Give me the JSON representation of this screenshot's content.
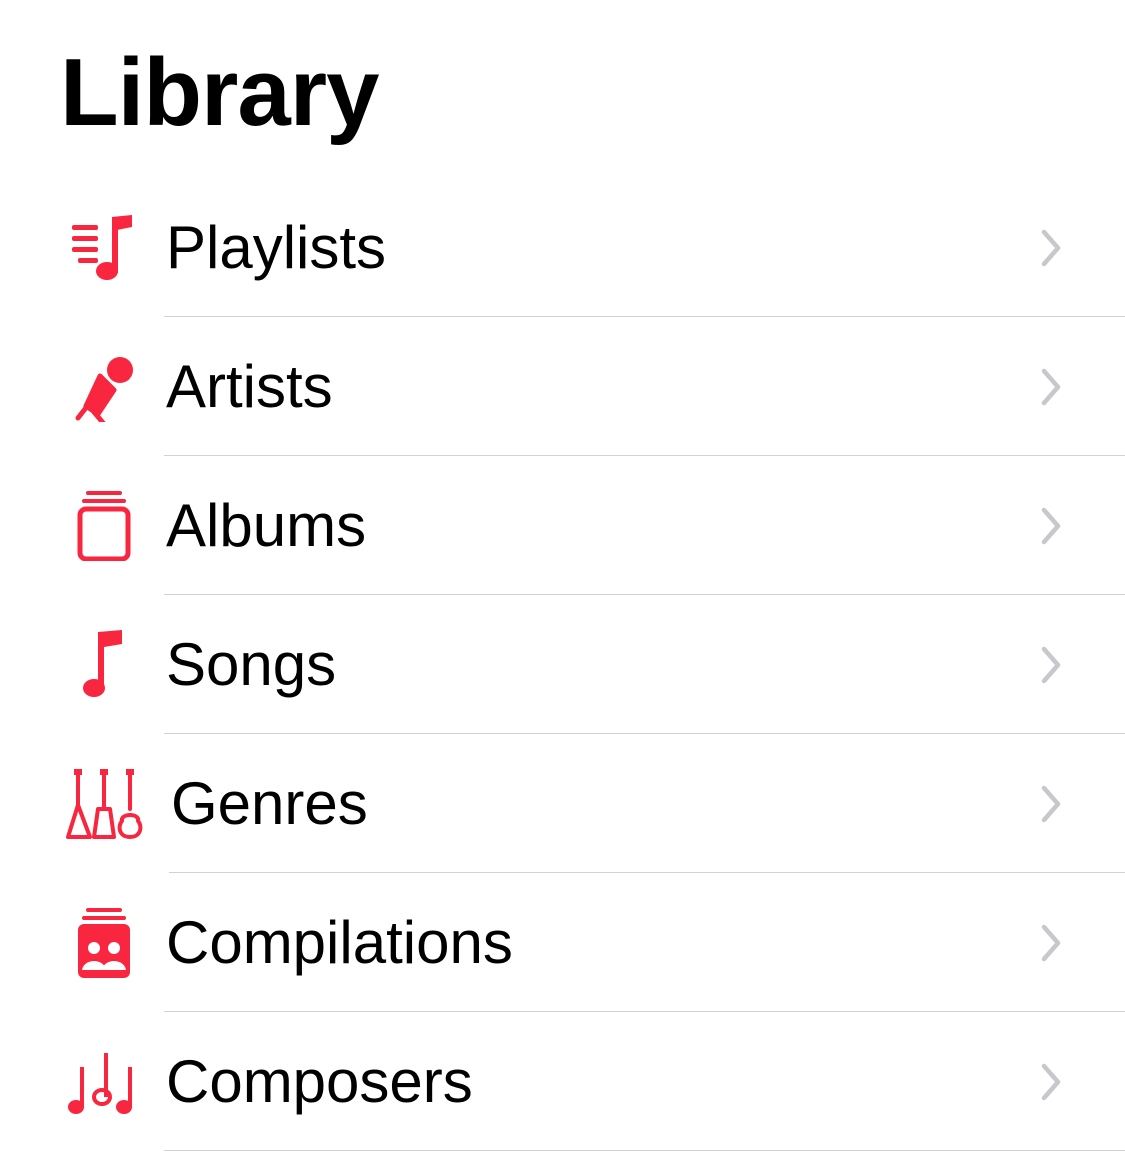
{
  "header": {
    "title": "Library"
  },
  "colors": {
    "accent": "#f8263f",
    "chevron": "#c7c7cc",
    "divider": "#d1d1d6"
  },
  "items": [
    {
      "label": "Playlists",
      "icon": "playlist-icon"
    },
    {
      "label": "Artists",
      "icon": "microphone-icon"
    },
    {
      "label": "Albums",
      "icon": "album-stack-icon"
    },
    {
      "label": "Songs",
      "icon": "music-note-icon"
    },
    {
      "label": "Genres",
      "icon": "guitars-icon"
    },
    {
      "label": "Compilations",
      "icon": "compilation-icon"
    },
    {
      "label": "Composers",
      "icon": "music-notes-icon"
    }
  ]
}
